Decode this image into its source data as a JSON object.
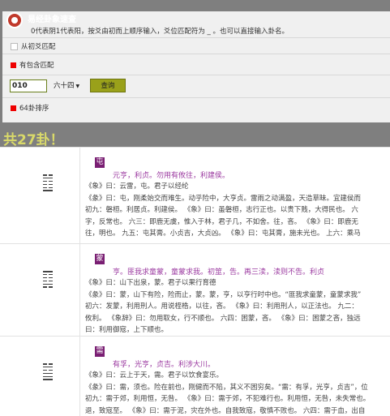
{
  "app": {
    "title": "易经卦象速查",
    "hint": "0代表阴1代表阳，按爻由初而上顺序输入，爻位匹配符为 _ 。也可以直接输入卦名。"
  },
  "options": {
    "from_first": "从初爻匹配",
    "contains": "有包含匹配",
    "sort64": "64卦排序"
  },
  "search": {
    "value": "010",
    "select_label": "六十四",
    "select_arrow": "▼",
    "button": "查询"
  },
  "result_title": "共27卦！",
  "colors": {
    "accent_red": "#ee0000",
    "gua_bg": "#7a1f73",
    "judgment": "#9b3aa0",
    "button": "#9aa11a"
  },
  "entries": [
    {
      "name": "屯",
      "lines": [
        1,
        0,
        0,
        0,
        1,
        0
      ],
      "judgment": "元亨，利贞。勿用有攸往，利建侯。",
      "text": [
        "《象》曰：云雷，屯。君子以经纶",
        "《彖》曰：屯，刚柔始交而难生。动乎险中，大亨贞。雷雨之动满盈，天造草昧。宜建侯而",
        "初九：磐桓。利居贞。利建侯。  《象》曰：虽磐桓，志行正也。以贵下贱，大得民也。  六",
        "字，反常也。  六三：即鹿无虞，惟入于林，君子几，不如舍。往，吝。  《象》曰：即鹿无",
        "往，明也。  九五：屯其膏。小贞吉，大贞凶。  《象》曰：屯其膏，施未光也。  上六：乘马"
      ]
    },
    {
      "name": "蒙",
      "lines": [
        0,
        1,
        0,
        0,
        0,
        1
      ],
      "judgment": "亨。匪我求童蒙，童蒙求我。初筮，告。再三渎，渎则不告。利贞",
      "text": [
        "《象》曰：山下出泉，蒙。君子以果行育德",
        "《彖》曰：蒙，山下有险，险而止，蒙。蒙，亨，以亨行时中也。“匪我求童蒙，童蒙求我”",
        "初六：发蒙，利用刑人。用说桎梏，以往，吝。  《象》曰：利用刑人，以正法也。  九二：",
        "攸利。  《象辞》曰：勿用取女，行不顺也。  六四：困蒙，吝。  《象》曰：困蒙之吝，独远",
        "曰：利用御寇，上下顺也。"
      ]
    },
    {
      "name": "需",
      "lines": [
        1,
        1,
        1,
        0,
        1,
        0
      ],
      "judgment": "有孚，光亨，贞吉。利涉大川。",
      "text": [
        "《象》曰：云上于天，需。君子以饮食宴乐。",
        "《彖》曰：需，须也。险在前也，刚健而不陷，其义不困穷矣。“需：有孚，光亨，贞吉”，位",
        "初九：需于郊，利用恒，无咎。  《象》曰：需于郊，不犯难行也。利用恒，无咎，未失常也。",
        "退，致寇至。  《象》曰：需于泥，灾在外也。自我致寇，敬慎不败也。  六四：需于血，出自"
      ]
    }
  ]
}
